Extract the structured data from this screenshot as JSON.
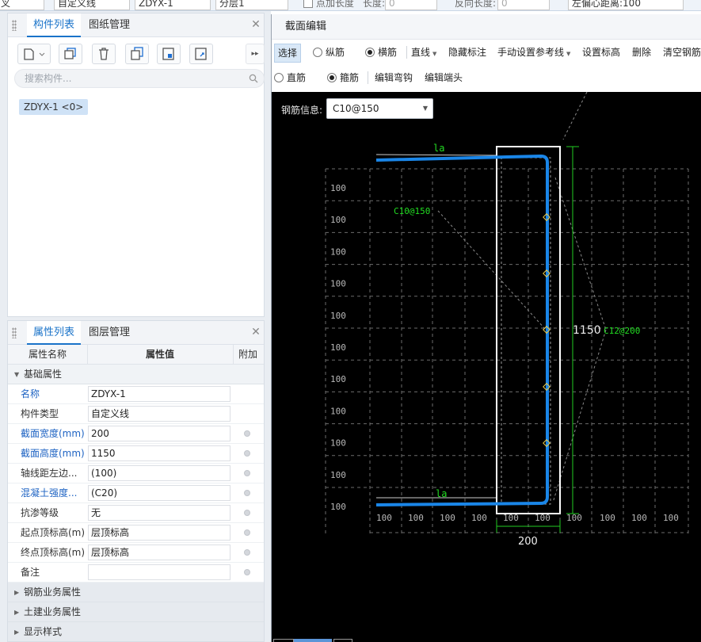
{
  "topbar": {
    "seg1": "叉",
    "seg2": "自定义线",
    "seg3": "ZDYX-1",
    "seg4": "分层1",
    "checkbox_label": "点加长度",
    "len_label": "长度:",
    "len_value": "0",
    "rev_label": "反向长度:",
    "rev_value": "0",
    "offset_label": "左偏心距离:",
    "offset_value": "100"
  },
  "component_panel": {
    "tabs": [
      "构件列表",
      "图纸管理"
    ],
    "search_placeholder": "搜索构件...",
    "items": [
      "ZDYX-1 <0>"
    ],
    "tool_icons": [
      "new-icon",
      "copy-icon",
      "delete-icon",
      "duplicate-icon",
      "floor-copy-icon",
      "layer-copy-icon",
      "more-icon"
    ]
  },
  "property_panel": {
    "tabs": [
      "属性列表",
      "图层管理"
    ],
    "headers": {
      "name": "属性名称",
      "value": "属性值",
      "extra": "附加"
    },
    "group_basic": "基础属性",
    "rows": [
      {
        "key": "名称",
        "value": "ZDYX-1",
        "blue": true,
        "dot": false
      },
      {
        "key": "构件类型",
        "value": "自定义线",
        "blue": false,
        "dot": false
      },
      {
        "key": "截面宽度(mm)",
        "value": "200",
        "blue": true,
        "dot": true
      },
      {
        "key": "截面高度(mm)",
        "value": "1150",
        "blue": true,
        "dot": true
      },
      {
        "key": "轴线距左边...",
        "value": "(100)",
        "blue": false,
        "dot": true
      },
      {
        "key": "混凝土强度...",
        "value": "(C20)",
        "blue": true,
        "dot": true
      },
      {
        "key": "抗渗等级",
        "value": "无",
        "blue": false,
        "dot": true
      },
      {
        "key": "起点顶标高(m)",
        "value": "层顶标高",
        "blue": false,
        "dot": true
      },
      {
        "key": "终点顶标高(m)",
        "value": "层顶标高",
        "blue": false,
        "dot": true
      },
      {
        "key": "备注",
        "value": "",
        "blue": false,
        "dot": true
      }
    ],
    "groups_collapsed": [
      "钢筋业务属性",
      "土建业务属性",
      "显示样式"
    ]
  },
  "dialog": {
    "title": "截面编辑",
    "toolbar1": {
      "select": "选择",
      "radio_long": "纵筋",
      "radio_trans": "横筋",
      "line": "直线",
      "hide_label": "隐藏标注",
      "manual_ref": "手动设置参考线",
      "set_elev": "设置标高",
      "delete": "删除",
      "clear": "清空钢筋"
    },
    "toolbar2": {
      "radio_straight": "直筋",
      "radio_stirrup": "箍筋",
      "edit_hook": "编辑弯钩",
      "edit_end": "编辑端头"
    },
    "rebar_info_label": "钢筋信息:",
    "rebar_info_value": "C10@150"
  },
  "drawing": {
    "grid_label": "100",
    "la_top": "la",
    "la_bottom": "la",
    "stirrup_label": "C10@150",
    "long_label": "C12@200",
    "height_dim": "1150",
    "width_dim": "200",
    "colors": {
      "rebar": "#1a86e8",
      "dim": "#22cc22",
      "grid": "#6b6b6b",
      "outline": "#ffffff",
      "label": "#22dd22",
      "point": "#f2d04a"
    }
  }
}
